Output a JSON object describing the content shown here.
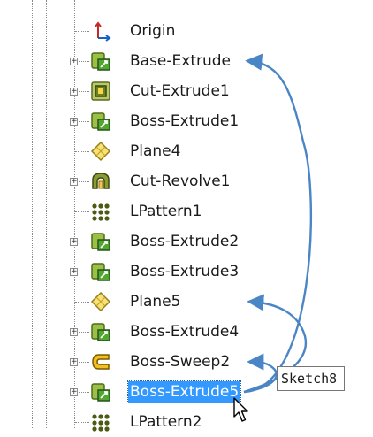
{
  "tree": {
    "items": [
      {
        "label": "Origin",
        "icon": "origin-icon",
        "expandable": false
      },
      {
        "label": "Base-Extrude",
        "icon": "extrude-feature-icon",
        "expandable": true
      },
      {
        "label": "Cut-Extrude1",
        "icon": "cut-extrude-icon",
        "expandable": true
      },
      {
        "label": "Boss-Extrude1",
        "icon": "extrude-feature-icon",
        "expandable": true
      },
      {
        "label": "Plane4",
        "icon": "plane-icon",
        "expandable": false
      },
      {
        "label": "Cut-Revolve1",
        "icon": "revolve-icon",
        "expandable": true
      },
      {
        "label": "LPattern1",
        "icon": "linear-pattern-icon",
        "expandable": false
      },
      {
        "label": "Boss-Extrude2",
        "icon": "extrude-feature-icon",
        "expandable": true
      },
      {
        "label": "Boss-Extrude3",
        "icon": "extrude-feature-icon",
        "expandable": true
      },
      {
        "label": "Plane5",
        "icon": "plane-icon",
        "expandable": false
      },
      {
        "label": "Boss-Extrude4",
        "icon": "extrude-feature-icon",
        "expandable": true
      },
      {
        "label": "Boss-Sweep2",
        "icon": "sweep-icon",
        "expandable": true
      },
      {
        "label": "Boss-Extrude5",
        "icon": "extrude-feature-icon",
        "expandable": true,
        "selected": true
      },
      {
        "label": "LPattern2",
        "icon": "linear-pattern-icon",
        "expandable": false
      }
    ]
  },
  "expander_symbol": "+",
  "tooltip": {
    "text": "Sketch8"
  },
  "colors": {
    "selection": "#3399ff",
    "parent_child_arrows": "#4a86c5"
  }
}
